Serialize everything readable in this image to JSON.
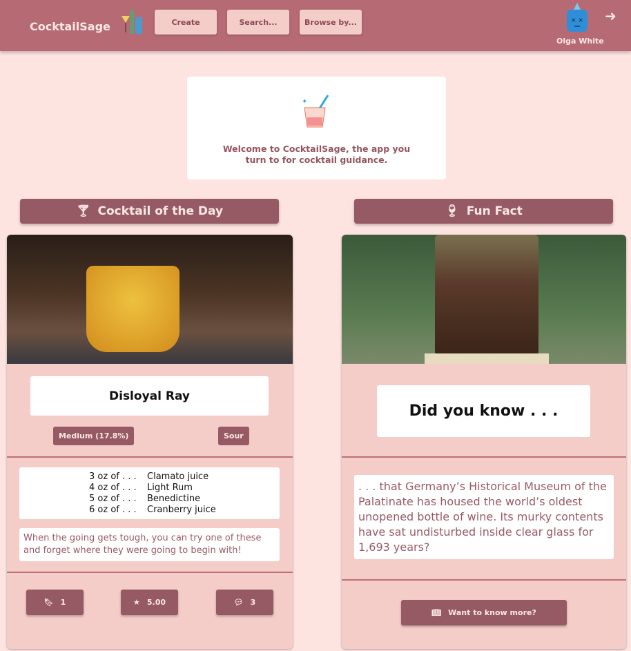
{
  "nav": {
    "brand": "CocktailSage",
    "buttons": [
      "Create",
      "Search...",
      "Browse by..."
    ],
    "user": "Olga White"
  },
  "welcome": {
    "text": "Welcome to CocktailSage, the app you turn to for cocktail guidance."
  },
  "cocktail": {
    "header": "Cocktail of the Day",
    "name": "Disloyal Ray",
    "strength": "Medium (17.8%)",
    "flavor": "Sour",
    "ingredients": [
      {
        "amount": "3 oz of . . .",
        "name": "Clamato juice"
      },
      {
        "amount": "4 oz of . . .",
        "name": "Light Rum"
      },
      {
        "amount": "5 oz of . . .",
        "name": "Benedictine"
      },
      {
        "amount": "6 oz of . . .",
        "name": "Cranberry juice"
      }
    ],
    "description": "When the going gets tough, you can try one of these and forget where they were going to begin with!",
    "bookmarks": "1",
    "rating": "5.00",
    "comments": "3"
  },
  "fact": {
    "header": "Fun Fact",
    "title": "Did you know . . .",
    "text": ". . . that Germany’s Historical Museum of the Palatinate has housed the world’s oldest unopened bottle of wine. Its murky contents have sat undisturbed inside clear glass for 1,693 years?",
    "more": "Want to know more?"
  }
}
